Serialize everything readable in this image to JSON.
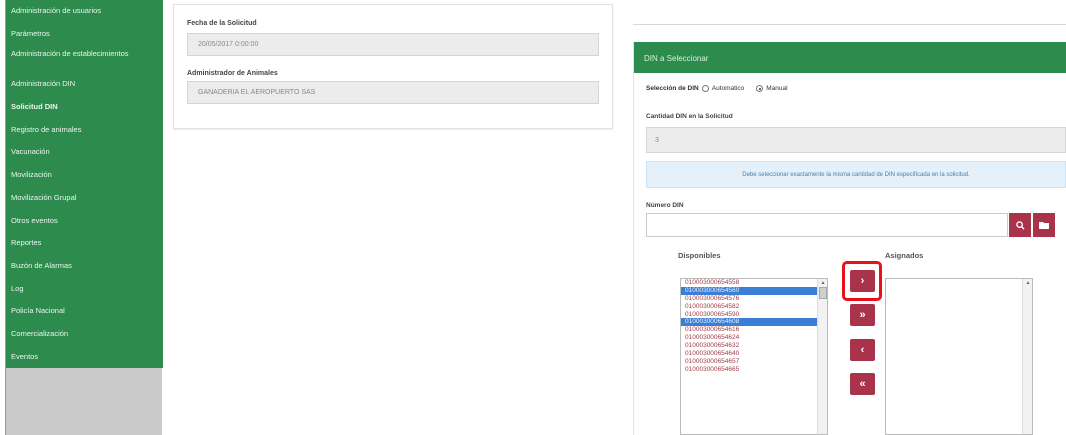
{
  "sidebar": {
    "items": [
      {
        "label": "Administración de usuarios"
      },
      {
        "label": "Parámetros"
      },
      {
        "label": "Administración de establecimientos"
      },
      {
        "label": "Administración DIN"
      },
      {
        "label": "Solicitud DIN"
      },
      {
        "label": "Registro de animales"
      },
      {
        "label": "Vacunación"
      },
      {
        "label": "Movilización"
      },
      {
        "label": "Movilización Grupal"
      },
      {
        "label": "Otros eventos"
      },
      {
        "label": "Reportes"
      },
      {
        "label": "Buzón de Alarmas"
      },
      {
        "label": "Log"
      },
      {
        "label": "Policía Nacional"
      },
      {
        "label": "Comercialización"
      },
      {
        "label": "Eventos"
      }
    ]
  },
  "request": {
    "date_label": "Fecha de la Solicitud",
    "date_value": "20/05/2017 0:00:00",
    "admin_label": "Administrador de Animales",
    "admin_value": "GANADERIA EL AEROPUERTO SAS"
  },
  "din_panel": {
    "title": "DIN a Seleccionar",
    "selection_label": "Selección de DIN",
    "option_auto": "Automatico",
    "option_manual": "Manual",
    "qty_label": "Cantidad DIN en la Solicitud",
    "qty_value": "3",
    "info_text": "Debe seleccionar exactamente la misma cantidad de DIN especificada en la solicitud.",
    "number_label": "Número DIN",
    "available_header": "Disponibles",
    "assigned_header": "Asignados",
    "available_items": [
      {
        "code": "010003000654558",
        "selected": false
      },
      {
        "code": "010003000654560",
        "selected": true
      },
      {
        "code": "010003000654576",
        "selected": false
      },
      {
        "code": "010003000654582",
        "selected": false
      },
      {
        "code": "010003000654590",
        "selected": false
      },
      {
        "code": "010003000654608",
        "selected": true
      },
      {
        "code": "010003000654616",
        "selected": false
      },
      {
        "code": "010003000654624",
        "selected": false
      },
      {
        "code": "010003000654632",
        "selected": false
      },
      {
        "code": "010003000654640",
        "selected": false
      },
      {
        "code": "010003000654657",
        "selected": false
      },
      {
        "code": "010003000654665",
        "selected": false
      }
    ],
    "buttons": {
      "move_right": "›",
      "move_all_right": "»",
      "move_left": "‹",
      "move_all_left": "«",
      "search_icon": "search-icon",
      "folder_icon": "folder-icon"
    }
  },
  "colors": {
    "sidebar_green": "#2e8b4e",
    "button_red": "#a8334a",
    "highlight_red": "#e8101c",
    "list_selected": "#3a7fd5"
  }
}
